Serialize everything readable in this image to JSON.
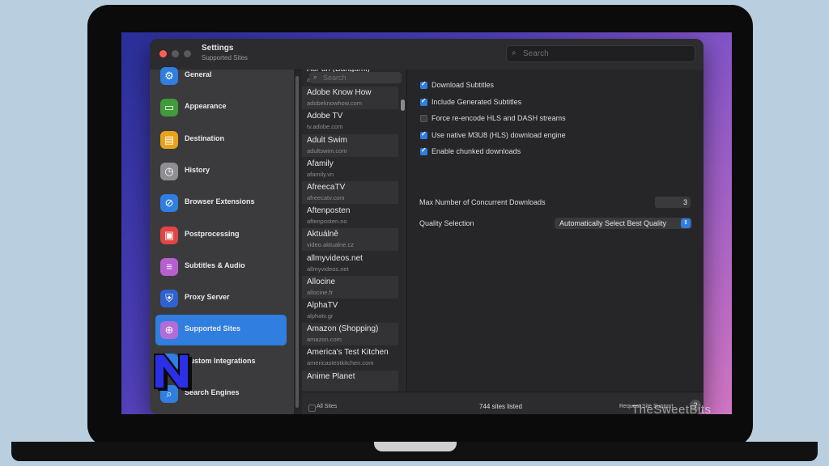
{
  "window": {
    "title": "Settings",
    "subtitle": "Supported Sites",
    "search_placeholder": "Search"
  },
  "traffic_lights": [
    "#ff5f57",
    "#5a5a5c",
    "#5a5a5c"
  ],
  "sidebar": {
    "items": [
      {
        "label": "General",
        "icon": "gear-icon",
        "color": "#2f7ee0"
      },
      {
        "label": "Appearance",
        "icon": "appearance-icon",
        "color": "#3f9b3b"
      },
      {
        "label": "Destination",
        "icon": "drive-icon",
        "color": "#e8a21b"
      },
      {
        "label": "History",
        "icon": "clock-icon",
        "color": "#8e8e93"
      },
      {
        "label": "Browser Extensions",
        "icon": "compass-icon",
        "color": "#2f7ee0"
      },
      {
        "label": "Postprocessing",
        "icon": "film-icon",
        "color": "#e04646"
      },
      {
        "label": "Subtitles & Audio",
        "icon": "subtitles-icon",
        "color": "#b85fd0"
      },
      {
        "label": "Proxy Server",
        "icon": "shield-icon",
        "color": "#2f62d0"
      },
      {
        "label": "Supported Sites",
        "icon": "globe-icon",
        "color": "#b16cd6",
        "selected": true
      },
      {
        "label": "Custom Integrations",
        "icon": "plug-icon",
        "color": "#2f7ee0"
      },
      {
        "label": "Search Engines",
        "icon": "magnifier-icon",
        "color": "#2f7ee0"
      }
    ]
  },
  "sites": {
    "search_placeholder": "Search",
    "items": [
      {
        "name": "AcFun (Bangumi)",
        "domain": "acfun.cn"
      },
      {
        "name": "Adobe Know How",
        "domain": "adobeknowhow.com"
      },
      {
        "name": "Adobe TV",
        "domain": "tv.adobe.com"
      },
      {
        "name": "Adult Swim",
        "domain": "adultswim.com"
      },
      {
        "name": "Afamily",
        "domain": "afamily.vn"
      },
      {
        "name": "AfreecaTV",
        "domain": "afreecatv.com"
      },
      {
        "name": "Aftenposten",
        "domain": "aftenposten.no"
      },
      {
        "name": "Aktuálně",
        "domain": "video.aktualne.cz"
      },
      {
        "name": "allmyvideos.net",
        "domain": "allmyvideos.net"
      },
      {
        "name": "Allocine",
        "domain": "allocine.fr"
      },
      {
        "name": "AlphaTV",
        "domain": "alphatv.gr"
      },
      {
        "name": "Amazon (Shopping)",
        "domain": "amazon.com"
      },
      {
        "name": "America's Test Kitchen",
        "domain": "americastestkitchen.com"
      },
      {
        "name": "Anime Planet",
        "domain": ""
      }
    ]
  },
  "main": {
    "options": [
      {
        "label": "Download Subtitles",
        "checked": true
      },
      {
        "label": "Include Generated Subtitles",
        "checked": true
      },
      {
        "label": "Force re-encode HLS and DASH streams",
        "checked": false
      },
      {
        "label": "Use native M3U8 (HLS) download engine",
        "checked": true
      },
      {
        "label": "Enable chunked downloads",
        "checked": true
      }
    ],
    "concurrent_label": "Max Number of Concurrent Downloads",
    "concurrent_value": "3",
    "quality_label": "Quality Selection",
    "quality_value": "Automatically Select Best Quality"
  },
  "footer": {
    "all_sites": "All Sites",
    "count": "744 sites listed",
    "request": "Request Site Support",
    "help": "?"
  },
  "watermark": "TheSweetBits",
  "accent": "#2f7ee0"
}
